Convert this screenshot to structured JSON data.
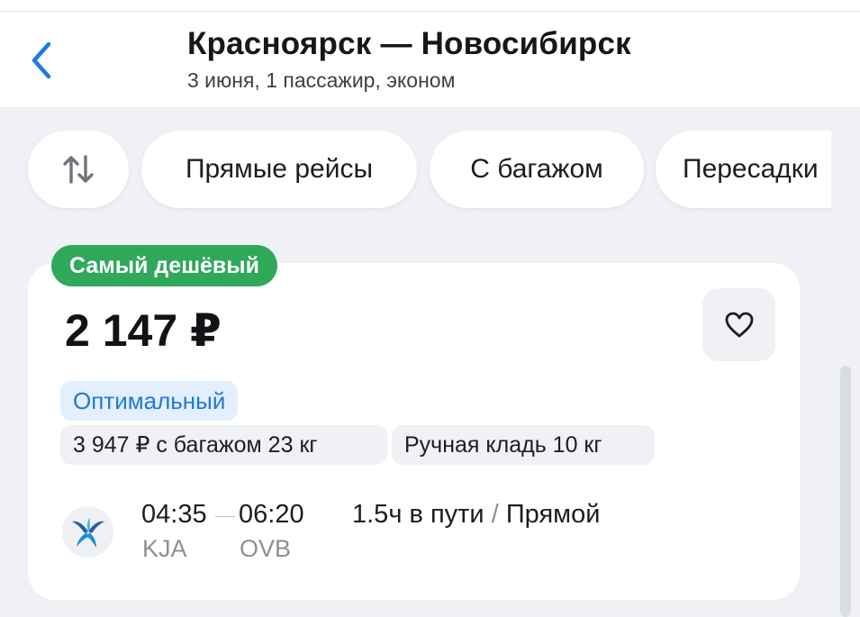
{
  "header": {
    "title": "Красноярск — Новосибирск",
    "subtitle": "3 июня, 1 пассажир, эконом",
    "back_icon": "chevron-left-icon"
  },
  "filters": {
    "sort_icon": "sort-arrows-icon",
    "items": [
      {
        "label": "Прямые рейсы"
      },
      {
        "label": "С багажом"
      },
      {
        "label": "Пересадки"
      }
    ]
  },
  "offer": {
    "badge": "Самый дешёвый",
    "price": "2 147 ₽",
    "favorite_icon": "heart-icon",
    "fare_tag": "Оптимальный",
    "baggage_option": "3 947 ₽ с багажом 23 кг",
    "hand_luggage": "Ручная кладь 10 кг",
    "airline_logo": "airline-bird-logo",
    "departure_time": "04:35",
    "arrival_time": "06:20",
    "departure_code": "KJA",
    "arrival_code": "OVB",
    "duration": "1.5ч в пути",
    "separator": "/",
    "stops": "Прямой"
  },
  "colors": {
    "badge_green": "#30a85a",
    "accent_blue": "#1f78e0",
    "tag_blue_bg": "#e3effc",
    "page_bg": "#eff1f4",
    "secondary_text": "#8b9097"
  }
}
